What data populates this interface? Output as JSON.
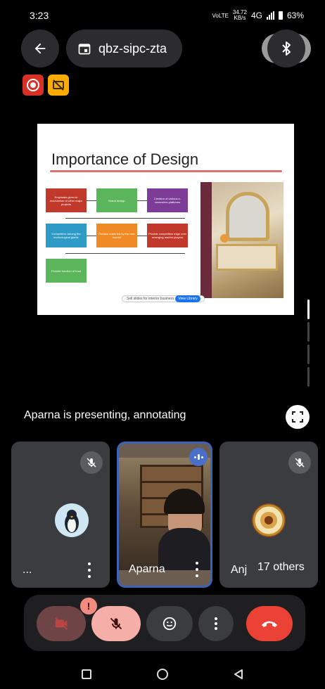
{
  "status_bar": {
    "time": "3:23",
    "network_type": "VoLTE",
    "net_speed_value": "34.72",
    "net_speed_unit": "KB/s",
    "signal": "4G",
    "battery": "63%"
  },
  "top_bar": {
    "meeting_code": "qbz-sipc-zta"
  },
  "slide": {
    "title": "Importance of Design",
    "flow_items": [
      "Emphasis given to mechanism of other major projects",
      "Brand design",
      "Creation of various e-commerce platforms",
      "Competitive among the technological giants",
      "Reduce costs led by the new market",
      "Provide competitive edge over emerging market players",
      "Provide function of trust"
    ],
    "footer_text": "Sell slides for interior business",
    "footer_button": "View Library"
  },
  "presenting_text": "Aparna is presenting, annotating",
  "tiles": [
    {
      "name": "..."
    },
    {
      "name": "Aparna"
    },
    {
      "name": "Anj"
    }
  ],
  "others_count": "17 others",
  "colors": {
    "background": "#000000",
    "tile_bg": "#3a3c40",
    "end_call": "#ea4335",
    "muted_pill": "#f6aea9",
    "active_border": "#3c63b5"
  }
}
